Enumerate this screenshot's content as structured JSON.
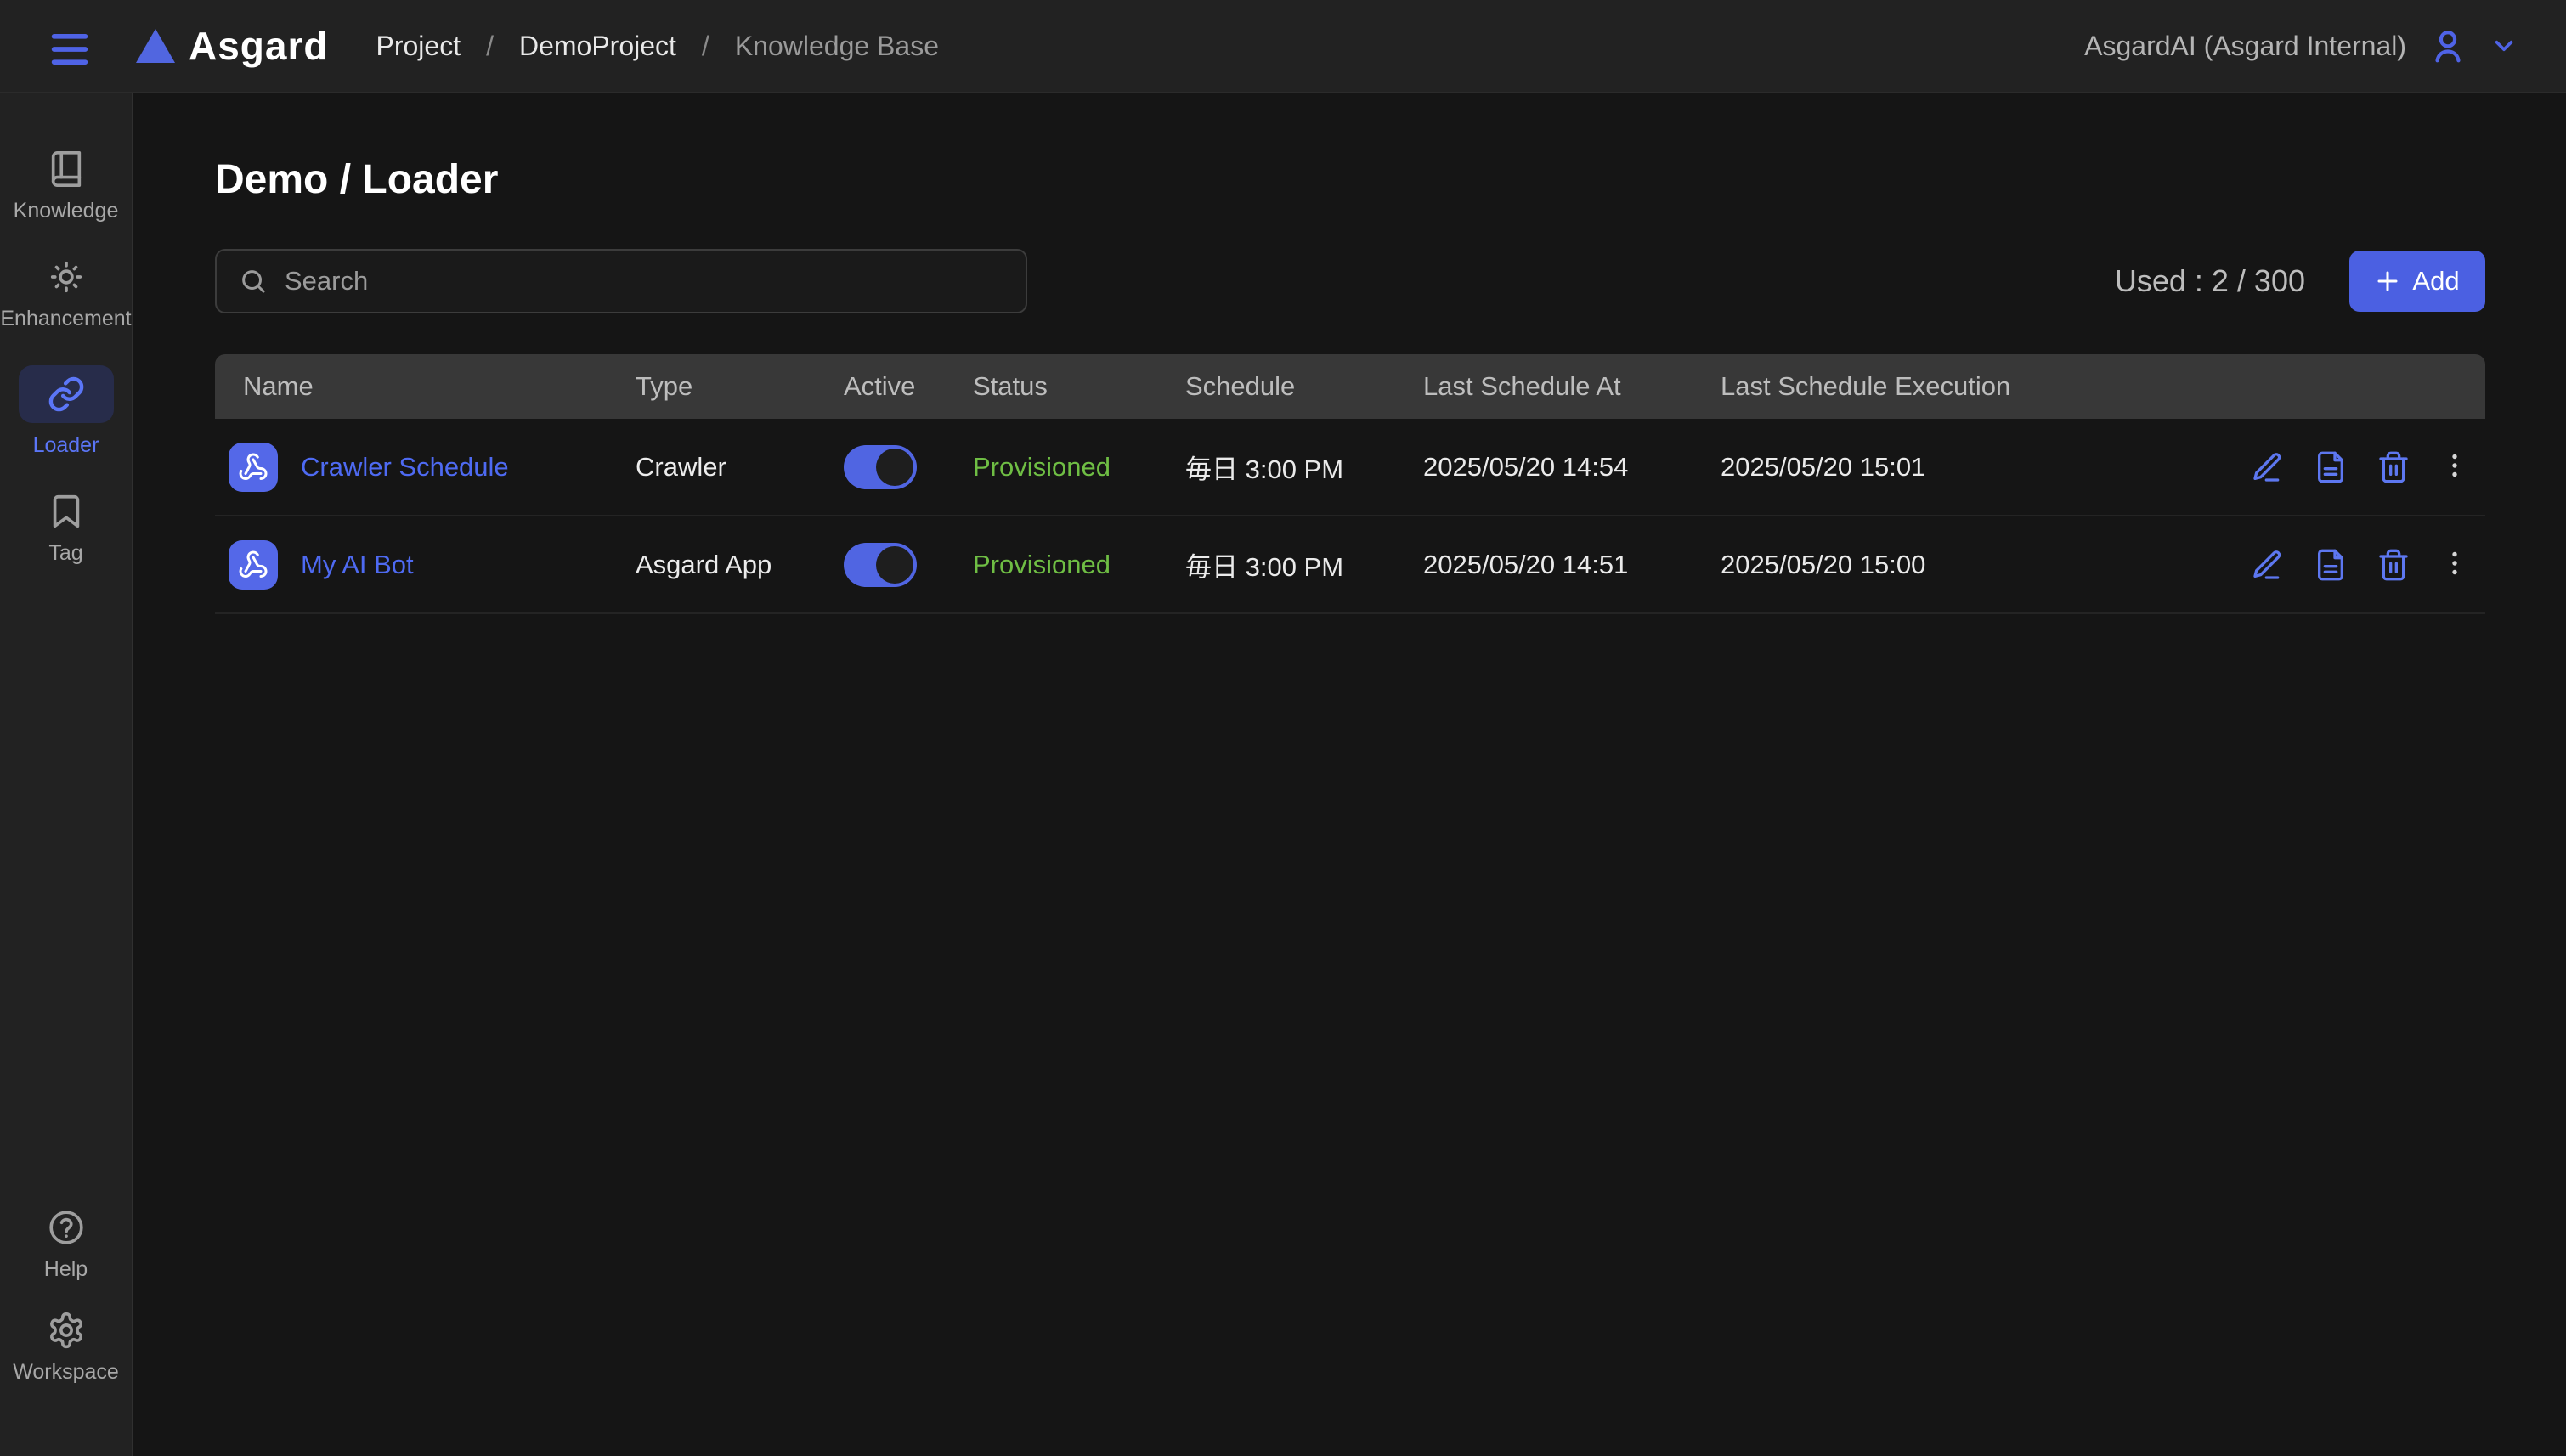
{
  "header": {
    "logo_text": "Asgard",
    "breadcrumb": {
      "project": "Project",
      "separator": "/",
      "demo_project": "DemoProject",
      "current": "Knowledge Base"
    },
    "account_name": "AsgardAI (Asgard Internal)"
  },
  "sidebar": {
    "items": [
      {
        "label": "Knowledge",
        "icon": "book-icon",
        "active": false
      },
      {
        "label": "Enhancement",
        "icon": "sun-icon",
        "active": false
      },
      {
        "label": "Loader",
        "icon": "link-icon",
        "active": true
      },
      {
        "label": "Tag",
        "icon": "bookmark-icon",
        "active": false
      }
    ],
    "bottom_items": [
      {
        "label": "Help",
        "icon": "help-circle-icon"
      },
      {
        "label": "Workspace",
        "icon": "gear-icon"
      }
    ]
  },
  "main": {
    "title": "Demo / Loader",
    "search_placeholder": "Search",
    "usage_text": "Used : 2 / 300",
    "add_button_label": "Add",
    "table": {
      "columns": [
        "Name",
        "Type",
        "Active",
        "Status",
        "Schedule",
        "Last Schedule At",
        "Last Schedule Execution"
      ],
      "rows": [
        {
          "name": "Crawler Schedule",
          "type": "Crawler",
          "active": true,
          "status": "Provisioned",
          "schedule": "毎日 3:00 PM",
          "last_schedule_at": "2025/05/20 14:54",
          "last_schedule_execution": "2025/05/20 15:01"
        },
        {
          "name": "My AI Bot",
          "type": "Asgard App",
          "active": true,
          "status": "Provisioned",
          "schedule": "毎日 3:00 PM",
          "last_schedule_at": "2025/05/20 14:51",
          "last_schedule_execution": "2025/05/20 15:00"
        }
      ]
    }
  },
  "colors": {
    "accent_blue": "#4f63e6",
    "link_blue": "#4e6af2",
    "status_green": "#6fbe44",
    "active_pill_bg": "#272c4a",
    "table_header_bg": "#383838",
    "topbar_bg": "#222222",
    "main_bg": "#151515"
  }
}
